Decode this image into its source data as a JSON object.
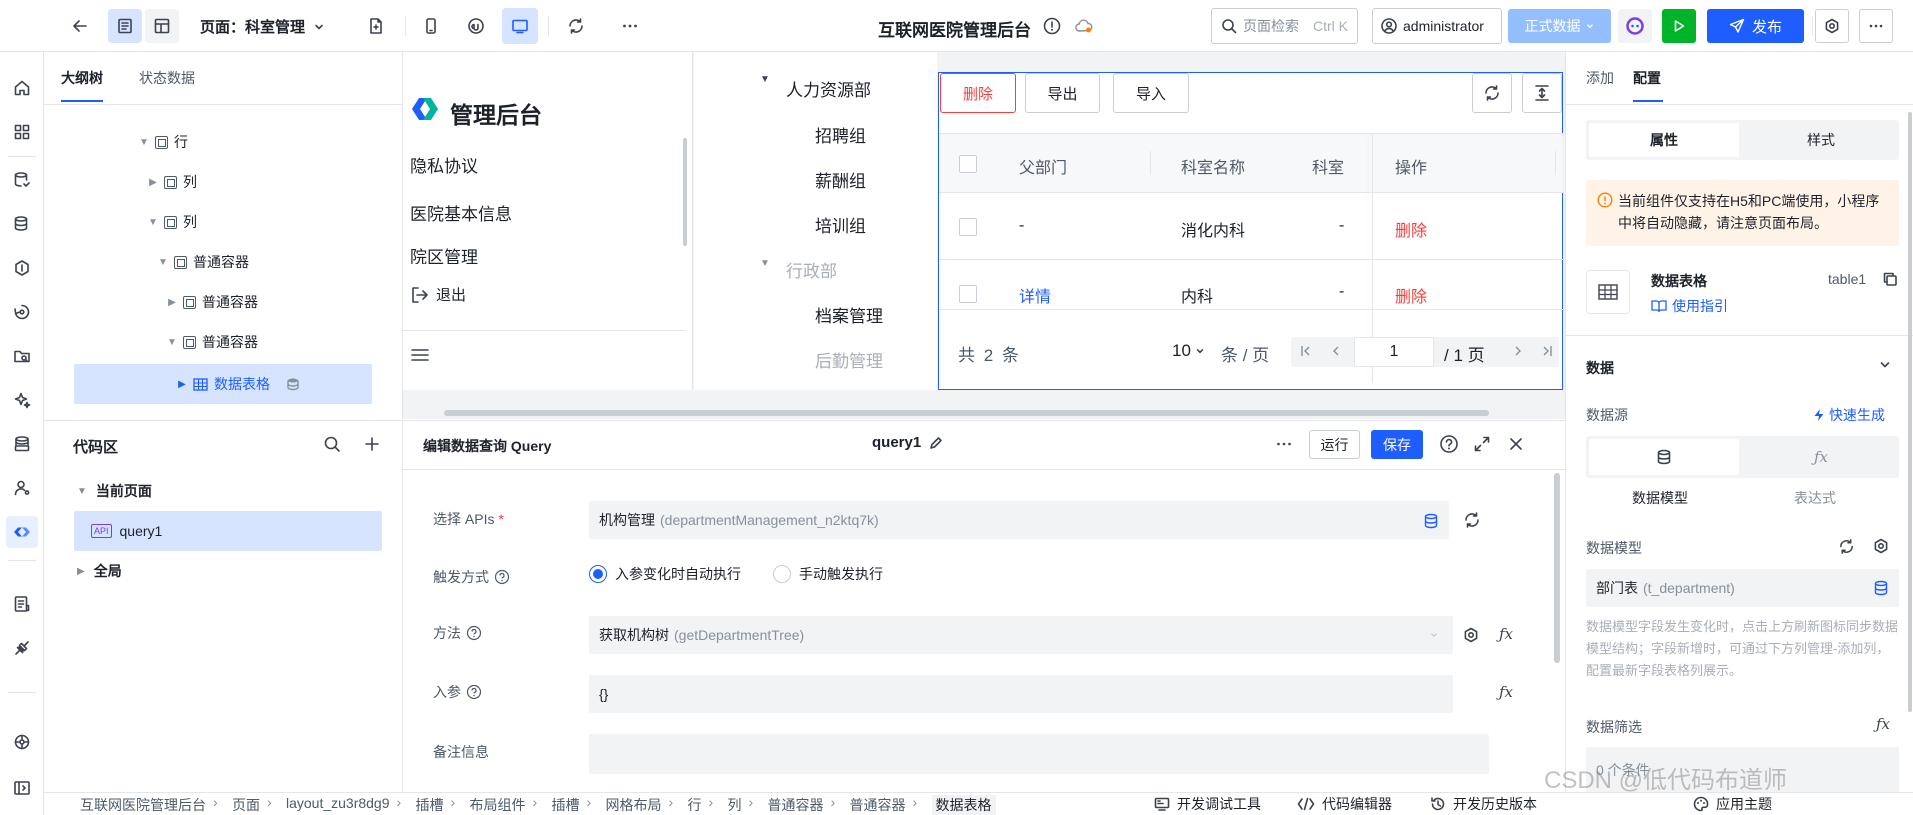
{
  "header": {
    "page_selector_label": "页面：科室管理",
    "app_title": "互联网医院管理后台",
    "search_placeholder": "页面检索",
    "search_shortcut": "Ctrl K",
    "user_name": "administrator",
    "env_label": "正式数据",
    "publish_label": "发布"
  },
  "outline": {
    "tabs": [
      "大纲树",
      "状态数据"
    ],
    "nodes": [
      {
        "label": "行",
        "expanded": true
      },
      {
        "label": "列",
        "expanded": false
      },
      {
        "label": "列",
        "expanded": true
      },
      {
        "label": "普通容器",
        "expanded": true
      },
      {
        "label": "普通容器",
        "expanded": false
      },
      {
        "label": "普通容器",
        "expanded": true
      },
      {
        "label": "数据表格",
        "expanded": false,
        "selected": true
      }
    ]
  },
  "code_area": {
    "title": "代码区",
    "current_page_label": "当前页面",
    "query_item": "query1",
    "api_badge": "API",
    "global_label": "全局"
  },
  "preview": {
    "logo_text": "管理后台",
    "sidebar_menu": [
      "隐私协议",
      "医院基本信息",
      "院区管理"
    ],
    "logout_label": "退出",
    "dept_tree": [
      {
        "label": "人力资源部",
        "level": 0,
        "muted": false
      },
      {
        "label": "招聘组",
        "level": 1,
        "muted": false
      },
      {
        "label": "薪酬组",
        "level": 1,
        "muted": false
      },
      {
        "label": "培训组",
        "level": 1,
        "muted": false
      },
      {
        "label": "行政部",
        "level": 0,
        "muted": true
      },
      {
        "label": "档案管理",
        "level": 1,
        "muted": false
      },
      {
        "label": "后勤管理",
        "level": 1,
        "muted": true
      }
    ],
    "toolbar": {
      "delete": "删除",
      "export": "导出",
      "import": "导入"
    },
    "table_headers": [
      "父部门",
      "科室名称",
      "科室",
      "操作"
    ],
    "table_rows": [
      {
        "parent": "-",
        "name": "消化内科",
        "code": "-",
        "action": "删除",
        "parent_link": false
      },
      {
        "parent": "详情",
        "name": "内科",
        "code": "-",
        "action": "删除",
        "parent_link": true
      }
    ],
    "pagination": {
      "total": "共 2 条",
      "page_size": "10",
      "per_page": "条 / 页",
      "page": "1",
      "pages": "/ 1 页"
    }
  },
  "query_editor": {
    "title": "编辑数据查询 Query",
    "query_name": "query1",
    "run_label": "运行",
    "save_label": "保存",
    "fields": {
      "api_label": "选择 APIs",
      "api_required": "*",
      "api_value": "机构管理",
      "api_sub": "(departmentManagement_n2ktq7k)",
      "trigger_label": "触发方式",
      "trigger_auto": "入参变化时自动执行",
      "trigger_manual": "手动触发执行",
      "method_label": "方法",
      "method_value": "获取机构树",
      "method_sub": "(getDepartmentTree)",
      "params_label": "入参",
      "params_value": "{}",
      "remark_label": "备注信息"
    }
  },
  "right_panel": {
    "tabs": [
      "添加",
      "配置"
    ],
    "seg": [
      "属性",
      "样式"
    ],
    "notice": "当前组件仅支持在H5和PC端使用，小程序中将自动隐藏，请注意页面布局。",
    "component_name": "数据表格",
    "component_id": "table1",
    "guide_link": "使用指引",
    "data_section": "数据",
    "datasource_label": "数据源",
    "quick_gen": "快速生成",
    "ds_modes": [
      "数据模型",
      "表达式"
    ],
    "model_label": "数据模型",
    "model_value": "部门表",
    "model_sub": "(t_department)",
    "model_hint": "数据模型字段发生变化时，点击上方刷新图标同步数据模型结构；字段新增时，可通过下方列管理-添加列，配置最新字段表格列展示。",
    "filter_label": "数据筛选",
    "filter_value": "0 个条件"
  },
  "status_bar": {
    "breadcrumb": [
      "互联网医院管理后台",
      "页面",
      "layout_zu3r8dg9",
      "插槽",
      "布局组件",
      "插槽",
      "网格布局",
      "行",
      "列",
      "普通容器",
      "普通容器",
      "数据表格"
    ],
    "dev_tools": "开发调试工具",
    "code_editor": "代码编辑器",
    "history": "开发历史版本",
    "theme": "应用主题"
  },
  "watermark": "CSDN @低代码布道师",
  "colors": {
    "primary": "#1e5eff",
    "danger": "#f53f3f",
    "success": "#00b42a",
    "selected_bg": "#d6e4ff"
  }
}
